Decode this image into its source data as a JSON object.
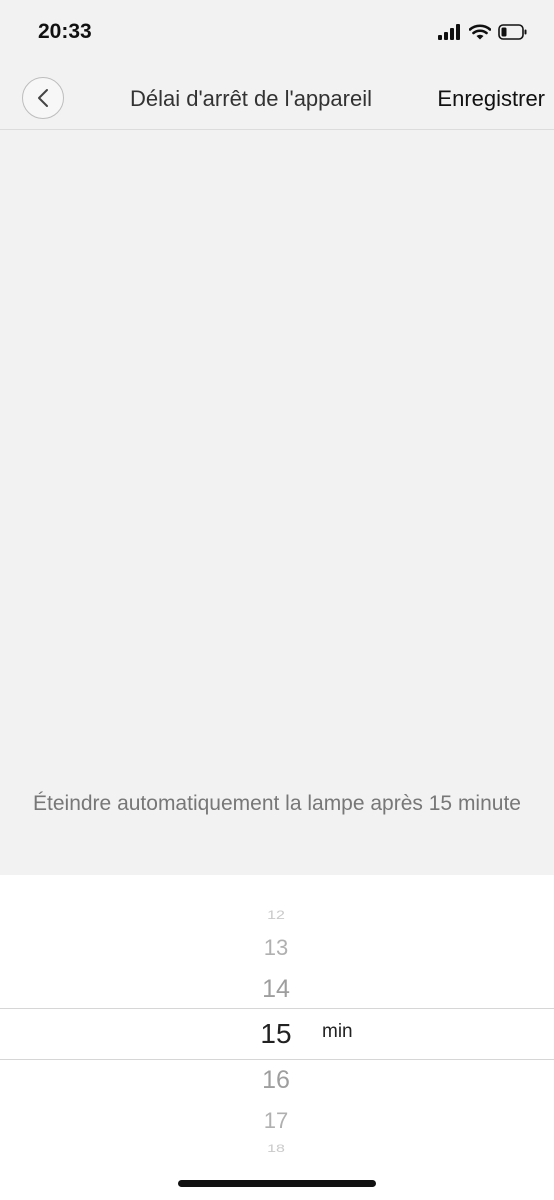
{
  "status_bar": {
    "time": "20:33"
  },
  "header": {
    "title": "Délai d'arrêt de l'appareil",
    "save_label": "Enregistrer"
  },
  "description": "Éteindre automatiquement la lampe après 15 minute",
  "picker": {
    "values": [
      "12",
      "13",
      "14",
      "15",
      "16",
      "17",
      "18"
    ],
    "selected": "15",
    "unit": "min"
  }
}
